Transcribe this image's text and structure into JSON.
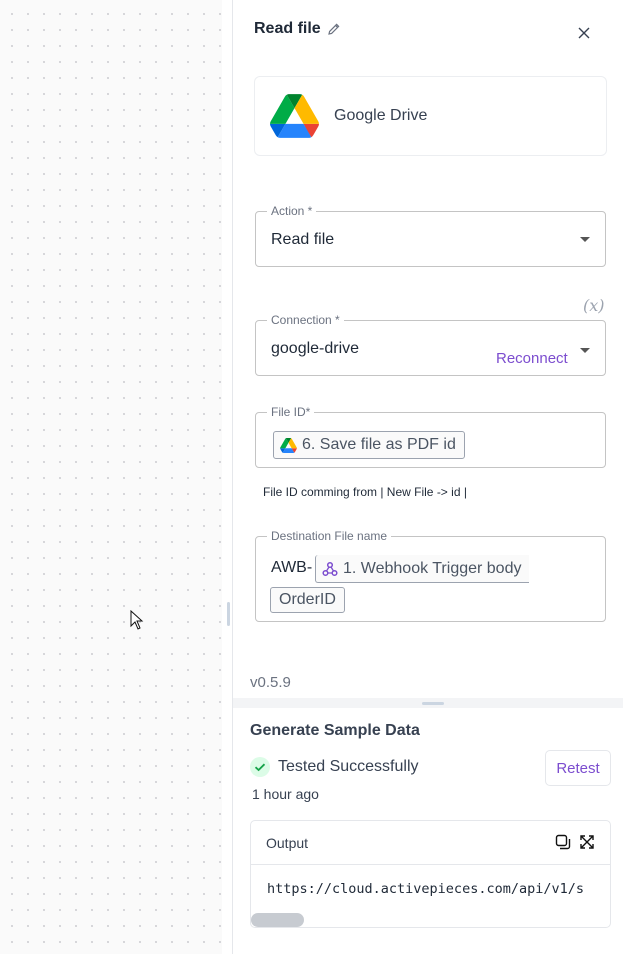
{
  "panel": {
    "title": "Read file",
    "piece_name": "Google Drive"
  },
  "fields": {
    "action": {
      "label": "Action *",
      "value": "Read file"
    },
    "connection": {
      "label": "Connection *",
      "value": "google-drive",
      "reconnect": "Reconnect"
    },
    "fx_label": "(x)",
    "file_id": {
      "label": "File ID*",
      "chip": "6. Save file as PDF id"
    },
    "hint": "File ID comming from | New File -> id |",
    "destination": {
      "label": "Destination File name",
      "prefix": "AWB-",
      "chip": "1. Webhook Trigger body",
      "chip2": "OrderID"
    }
  },
  "version": "v0.5.9",
  "sample": {
    "title": "Generate Sample Data",
    "status": "Tested Successfully",
    "time": "1 hour ago",
    "retest": "Retest",
    "output_label": "Output",
    "output_text": "https://cloud.activepieces.com/api/v1/s"
  },
  "colors": {
    "accent": "#7c4dcf",
    "success": "#16a34a"
  }
}
